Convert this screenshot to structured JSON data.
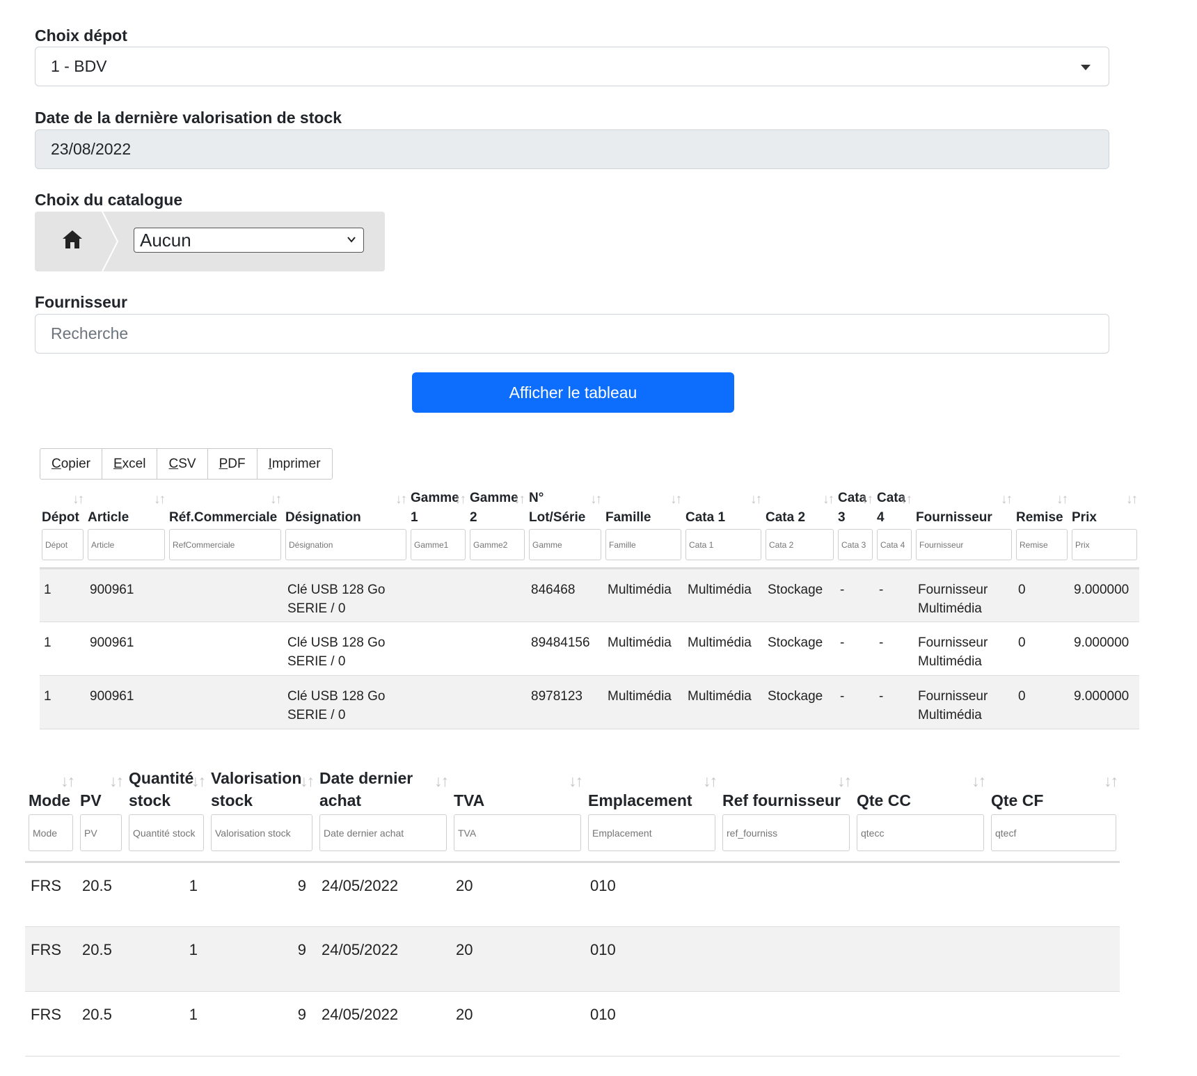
{
  "form": {
    "depot_label": "Choix dépot",
    "depot_value": "1 - BDV",
    "date_label": "Date de la dernière valorisation de stock",
    "date_value": "23/08/2022",
    "catalogue_label": "Choix du catalogue",
    "catalogue_value": "Aucun",
    "fournisseur_label": "Fournisseur",
    "fournisseur_placeholder": "Recherche",
    "submit_label": "Afficher le tableau"
  },
  "export": {
    "buttons": [
      {
        "key": "C",
        "rest": "opier"
      },
      {
        "key": "E",
        "rest": "xcel"
      },
      {
        "key": "C",
        "rest": "SV"
      },
      {
        "key": "P",
        "rest": "DF"
      },
      {
        "key": "I",
        "rest": "mprimer"
      }
    ]
  },
  "table1": {
    "headers": [
      "Dépot",
      "Article",
      "Réf.Commerciale",
      "Désignation",
      "Gamme 1",
      "Gamme 2",
      "N° Lot/Série",
      "Famille",
      "Cata 1",
      "Cata 2",
      "Cata 3",
      "Cata 4",
      "Fournisseur",
      "Remise",
      "Prix"
    ],
    "filters": [
      "Dépot",
      "Article",
      "RefCommerciale",
      "Désignation",
      "Gamme1",
      "Gamme2",
      "Gamme",
      "Famille",
      "Cata 1",
      "Cata 2",
      "Cata 3",
      "Cata 4",
      "Fournisseur",
      "Remise",
      "Prix"
    ],
    "rows": [
      [
        "1",
        "900961",
        "",
        "Clé USB 128 Go SERIE / 0",
        "",
        "",
        "846468",
        "Multimédia",
        "Multimédia",
        "Stockage",
        "-",
        "-",
        "Fournisseur Multimédia",
        "0",
        "9.000000"
      ],
      [
        "1",
        "900961",
        "",
        "Clé USB 128 Go SERIE / 0",
        "",
        "",
        "89484156",
        "Multimédia",
        "Multimédia",
        "Stockage",
        "-",
        "-",
        "Fournisseur Multimédia",
        "0",
        "9.000000"
      ],
      [
        "1",
        "900961",
        "",
        "Clé USB 128 Go SERIE / 0",
        "",
        "",
        "8978123",
        "Multimédia",
        "Multimédia",
        "Stockage",
        "-",
        "-",
        "Fournisseur Multimédia",
        "0",
        "9.000000"
      ]
    ]
  },
  "table2": {
    "headers": [
      "Mode",
      "PV",
      "Quantité stock",
      "Valorisation stock",
      "Date dernier achat",
      "TVA",
      "Emplacement",
      "Ref fournisseur",
      "Qte CC",
      "Qte CF"
    ],
    "filters": [
      "Mode",
      "PV",
      "Quantité stock",
      "Valorisation stock",
      "Date dernier achat",
      "TVA",
      "Emplacement",
      "ref_fourniss",
      "qtecc",
      "qtecf"
    ],
    "rows": [
      [
        "FRS",
        "20.5",
        "1",
        "9",
        "24/05/2022",
        "20",
        "010",
        "",
        "",
        ""
      ],
      [
        "FRS",
        "20.5",
        "1",
        "9",
        "24/05/2022",
        "20",
        "010",
        "",
        "",
        ""
      ],
      [
        "FRS",
        "20.5",
        "1",
        "9",
        "24/05/2022",
        "20",
        "010",
        "",
        "",
        ""
      ]
    ]
  },
  "colors": {
    "primary": "#0d6efd",
    "readonly_bg": "#e9ecef",
    "stripe": "#f2f2f2"
  },
  "icons": {
    "home": "home-icon",
    "sort": "sort-arrows-icon",
    "dropdown": "caret-down-icon"
  }
}
